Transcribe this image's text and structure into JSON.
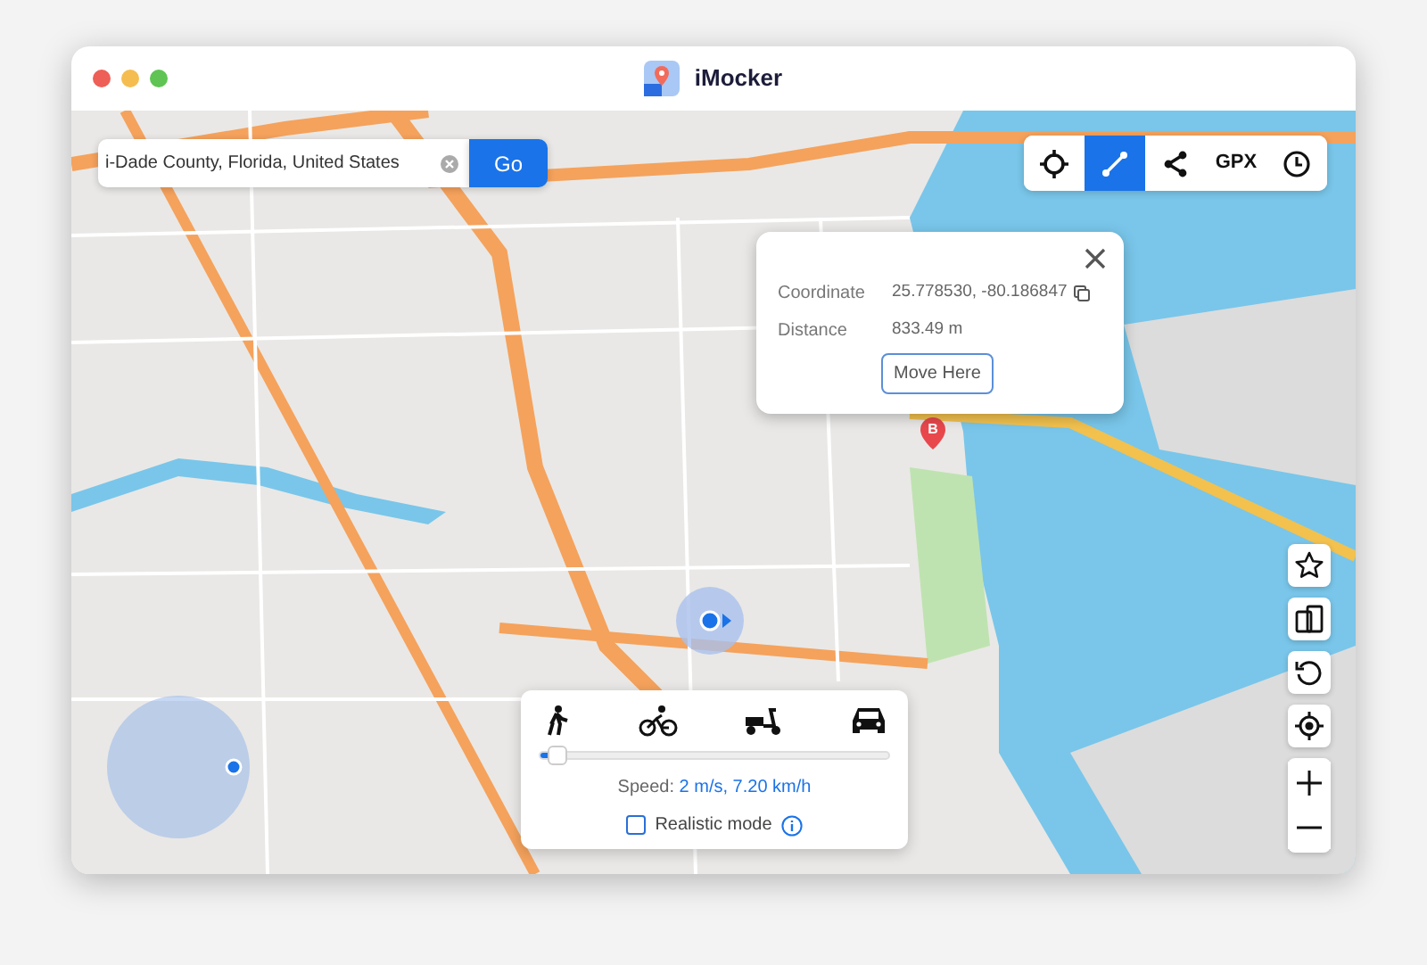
{
  "window": {
    "title": "iMocker"
  },
  "search": {
    "value": "i-Dade County, Florida, United States",
    "button": "Go"
  },
  "toolbar": [
    {
      "kind": "teleport",
      "selected": false
    },
    {
      "kind": "route",
      "selected": true
    },
    {
      "kind": "share",
      "selected": false
    },
    {
      "kind": "gpx",
      "label": "GPX",
      "selected": false
    },
    {
      "kind": "history",
      "selected": false
    }
  ],
  "popup": {
    "rows": [
      {
        "label": "Coordinate",
        "value": "25.778530, -80.186847",
        "copyable": true
      },
      {
        "label": "Distance",
        "value": "833.49 m",
        "copyable": false
      }
    ],
    "button": "Move Here",
    "pin": "B"
  },
  "speed": {
    "modes": [
      {
        "kind": "walk"
      },
      {
        "kind": "bike"
      },
      {
        "kind": "scooter"
      },
      {
        "kind": "car"
      }
    ],
    "level": 0.03,
    "label": "Speed:",
    "value": "2 m/s, 7.20 km/h",
    "realistic": {
      "label": "Realistic mode",
      "checked": false
    }
  },
  "side_buttons": [
    {
      "kind": "star"
    },
    {
      "kind": "devices"
    },
    {
      "kind": "reset"
    },
    {
      "kind": "locate"
    },
    {
      "kind": "zoom"
    }
  ]
}
